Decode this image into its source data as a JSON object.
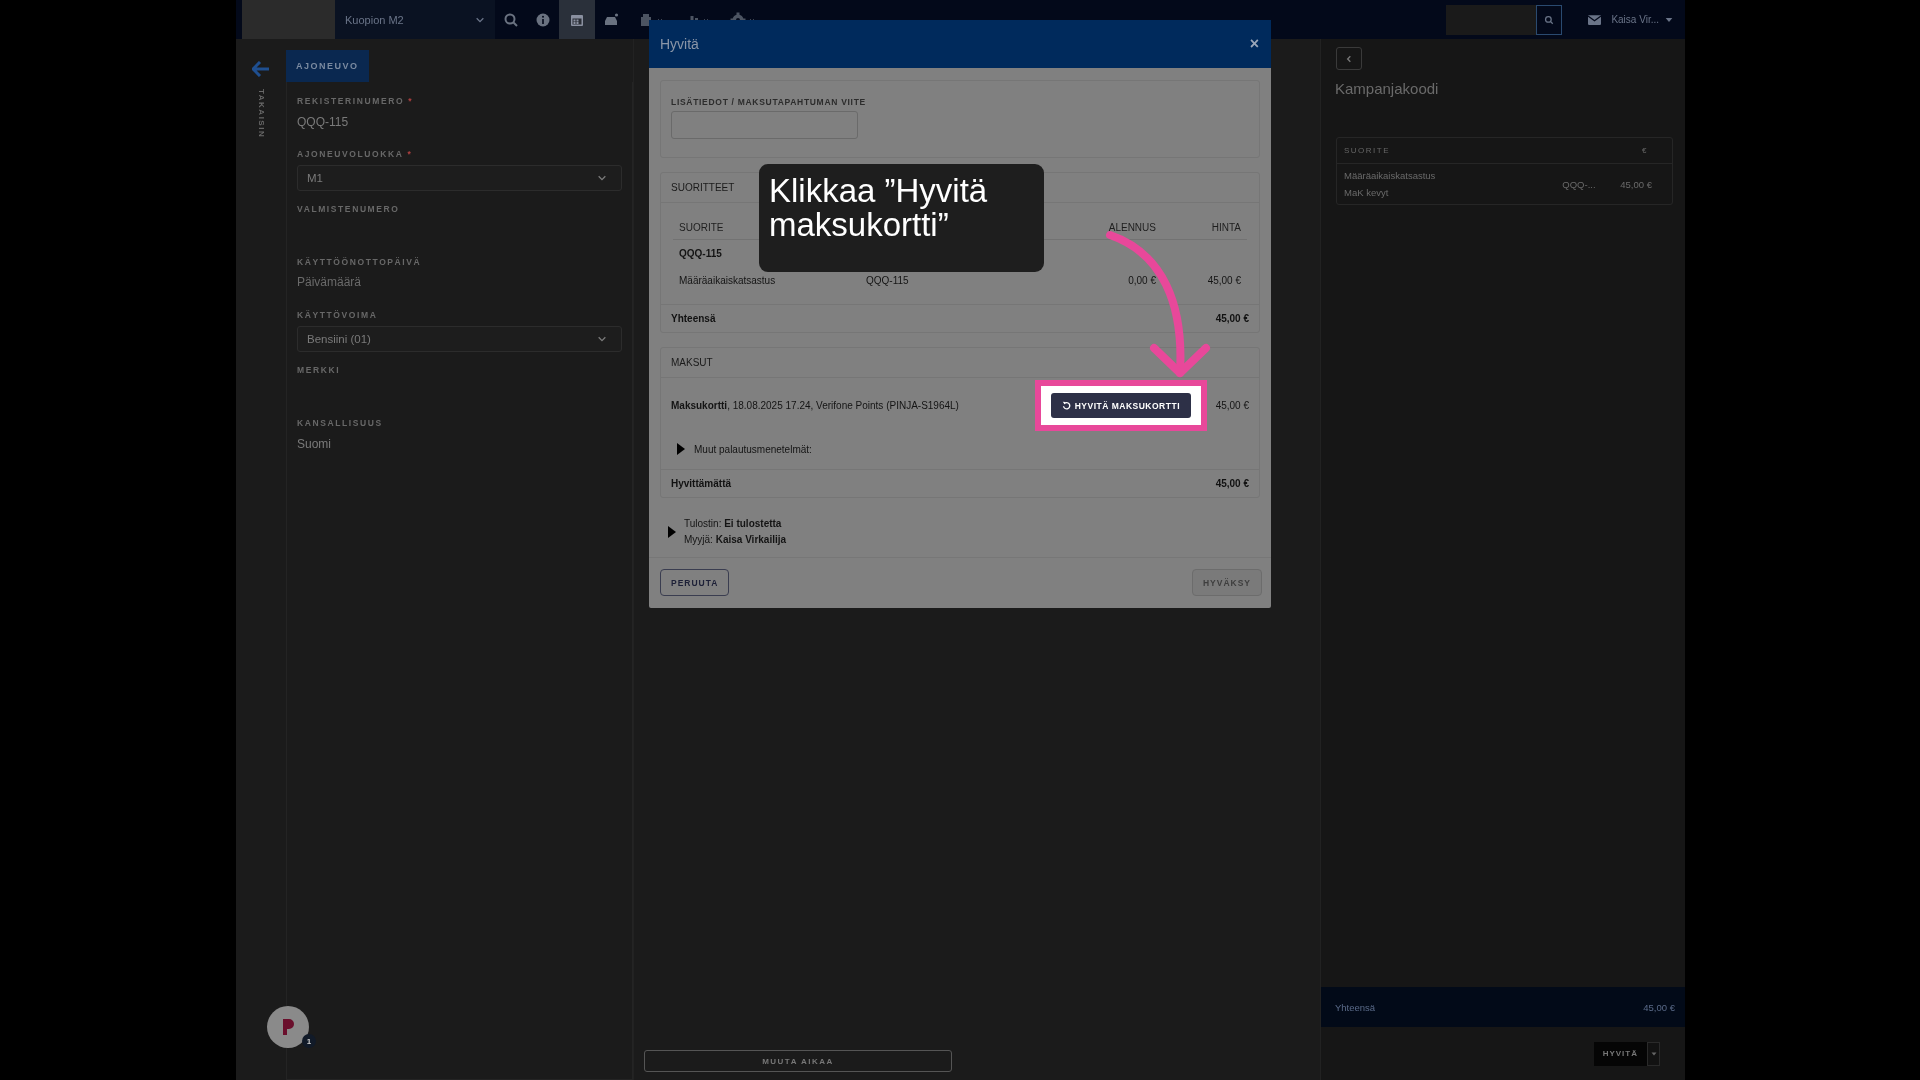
{
  "top_bar": {
    "location": "Kuopion M2",
    "nav_buttons": [
      {
        "selected": false
      },
      {
        "selected": false
      },
      {
        "selected": true
      },
      {
        "selected": false
      },
      {
        "selected": false
      },
      {
        "selected": false
      },
      {
        "selected": false
      }
    ],
    "user": "Kaisa Vir..."
  },
  "back": {
    "label": "TAKAISIN"
  },
  "vehicle_tab": {
    "label": "AJONEUVO",
    "selected": true
  },
  "vehicle_fields": [
    {
      "label": "REKISTERINUMERO",
      "required_mark": "*",
      "kind": "text",
      "value": "QQQ-115"
    },
    {
      "label": "AJONEUVOLUOKKA",
      "required_mark": "*",
      "kind": "select",
      "value": "M1"
    },
    {
      "label": "VALMISTENUMERO",
      "kind": "text"
    },
    {
      "label": "KÄYTTÖÖNOTTOPÄIVÄ",
      "kind": "date",
      "placeholder": "Päivämäärä"
    },
    {
      "label": "KÄYTTÖVOIMA",
      "kind": "select",
      "value": "Bensiini (01)"
    },
    {
      "label": "MERKKI",
      "kind": "text"
    },
    {
      "label": "KANSALLISUUS",
      "kind": "text",
      "value": "Suomi"
    }
  ],
  "change_time_button": "MUUTA AIKAA",
  "right_panel": {
    "title": "Kampanjakoodi",
    "columns": [
      "SUORITE",
      "€"
    ],
    "rows": [
      {
        "name": "Määräaikaiskatsastus",
        "subtitle": "MaK kevyt",
        "code": "QQQ-...",
        "price": "45,00 €"
      }
    ],
    "total_label": "Yhteensä",
    "total": "45,00 €",
    "refund_button": "HYVITÄ"
  },
  "notification_badge": "1",
  "modal": {
    "title": "Hyvitä",
    "close": "×",
    "reference": {
      "label": "LISÄTIEDOT / MAKSUTAPAHTUMAN VIITE"
    },
    "items": {
      "title": "SUORITTEET",
      "columns": [
        "SUORITE",
        "ALENNUS",
        "HINTA"
      ],
      "group": "QQQ-115",
      "rows": [
        {
          "name": "Määräaikaiskatsastus",
          "code": "QQQ-115",
          "discount": "0,00 €",
          "price": "45,00 €"
        }
      ],
      "total_label": "Yhteensä",
      "total": "45,00 €"
    },
    "payments": {
      "title": "MAKSUT",
      "rows": [
        {
          "text": "**Maksukortti**, 18.08.2025 17.24, Verifone Points (PINJA-S1964L)",
          "button": "HYVITÄ MAKSUKORTTI",
          "amount": "45,00 €"
        }
      ],
      "other_methods": {
        "label": "Muut palautusmenetelmät:",
        "expanded": false
      },
      "remaining_label": "Hyvittämättä",
      "remaining": "45,00 €"
    },
    "info": {
      "expanded": false,
      "lines": [
        "Tulostin: **Ei tulostetta**",
        "Myyjä: **Kaisa Virkailija**"
      ]
    },
    "cancel_button": {
      "label": "PERUUTA",
      "disabled": false
    },
    "accept_button": {
      "label": "HYVÄKSY",
      "disabled": true
    }
  },
  "tutorial": {
    "text": "Klikkaa ”Hyvitä maksukortti”"
  }
}
